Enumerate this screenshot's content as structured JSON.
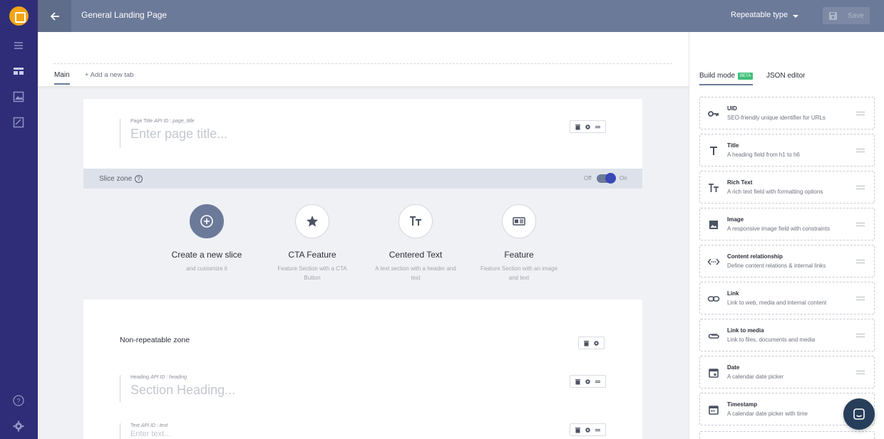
{
  "header": {
    "title": "General Landing Page",
    "repeatable_type": "Repeatable type",
    "save_label": "Save"
  },
  "tabs": {
    "main": "Main",
    "add": "+ Add a new tab"
  },
  "page_title_field": {
    "label": "Page Title",
    "api_id": "API ID : page_title",
    "placeholder": "Enter page title..."
  },
  "slice_zone": {
    "label": "Slice zone",
    "help": "?",
    "off": "Off",
    "on": "On",
    "enabled": true
  },
  "slices": [
    {
      "name": "Create a new slice",
      "desc": "and customize it",
      "icon": "plus-circle-icon"
    },
    {
      "name": "CTA Feature",
      "desc": "Feature Section with a CTA Button",
      "icon": "star-icon"
    },
    {
      "name": "Centered Text",
      "desc": "A text section with a header and text",
      "icon": "text-icon"
    },
    {
      "name": "Feature",
      "desc": "Feature Section with an image and text",
      "icon": "image-text-icon"
    }
  ],
  "non_repeatable": {
    "label": "Non-repeatable zone",
    "heading": {
      "label": "Heading",
      "api_id": "API ID : heading",
      "placeholder": "Section Heading..."
    },
    "text": {
      "label": "Text",
      "api_id": "API ID : text",
      "placeholder": "Enter text..."
    }
  },
  "right_panel": {
    "build_mode": "Build mode",
    "beta": "BETA",
    "json_editor": "JSON editor",
    "widgets": [
      {
        "title": "UID",
        "desc": "SEO-friendly unique identifier for URLs",
        "icon": "key-icon"
      },
      {
        "title": "Title",
        "desc": "A heading field from h1 to h6",
        "icon": "title-icon"
      },
      {
        "title": "Rich Text",
        "desc": "A rich text field with formatting options",
        "icon": "rich-text-icon"
      },
      {
        "title": "Image",
        "desc": "A responsive image field with constraints",
        "icon": "image-icon"
      },
      {
        "title": "Content relationship",
        "desc": "Define content relations & internal links",
        "icon": "relationship-icon"
      },
      {
        "title": "Link",
        "desc": "Link to web, media and internal content",
        "icon": "link-icon"
      },
      {
        "title": "Link to media",
        "desc": "Link to files, documents and media",
        "icon": "paperclip-icon"
      },
      {
        "title": "Date",
        "desc": "A calendar date picker",
        "icon": "calendar-icon"
      },
      {
        "title": "Timestamp",
        "desc": "A calendar date picker with time",
        "icon": "calendar-clock-icon"
      }
    ]
  },
  "colors": {
    "sidebar": "#2f2d77",
    "header": "#6c7a99",
    "accent": "#f2a515",
    "beta": "#3ec07a",
    "toggle": "#3748b7"
  }
}
